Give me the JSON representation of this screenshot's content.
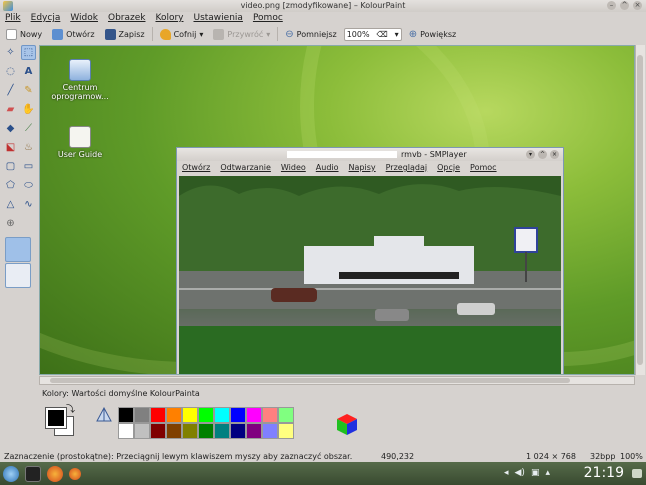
{
  "window": {
    "title": "video.png [zmodyfikowane] – KolourPaint"
  },
  "menu": [
    "Plik",
    "Edycja",
    "Widok",
    "Obrazek",
    "Kolory",
    "Ustawienia",
    "Pomoc"
  ],
  "toolbar": {
    "new": "Nowy",
    "open": "Otwórz",
    "save": "Zapisz",
    "undo": "Cofnij",
    "redo": "Przywróć",
    "zoom_out": "Pomniejsz",
    "zoom_value": "100%",
    "zoom_in": "Powiększ"
  },
  "desktop": {
    "icons": [
      {
        "label": "Centrum oprogramow..."
      },
      {
        "label": "User Guide"
      }
    ]
  },
  "player": {
    "title": "rmvb - SMPlayer",
    "menu": [
      "Otwórz",
      "Odtwarzanie",
      "Wideo",
      "Audio",
      "Napisy",
      "Przeglądaj",
      "Opcje",
      "Pomoc"
    ]
  },
  "colors": {
    "label": "Kolory: Wartości domyślne KolourPainta",
    "palette_top": [
      "#000000",
      "#808080",
      "#ff0000",
      "#ff8000",
      "#ffff00",
      "#00ff00",
      "#00ffff",
      "#0000ff",
      "#ff00ff",
      "#ff8080",
      "#80ff80"
    ],
    "palette_bottom": [
      "#ffffff",
      "#c0c0c0",
      "#800000",
      "#804000",
      "#808000",
      "#008000",
      "#008080",
      "#000080",
      "#800080",
      "#8080ff",
      "#ffff80"
    ]
  },
  "status": {
    "hint": "Zaznaczenie (prostokątne): Przeciągnij lewym klawiszem myszy aby zaznaczyć obszar.",
    "coords": "490,232",
    "size": "1 024 × 768",
    "depth": "32bpp",
    "zoom": "100%"
  },
  "taskbar": {
    "clock": "21:19"
  }
}
